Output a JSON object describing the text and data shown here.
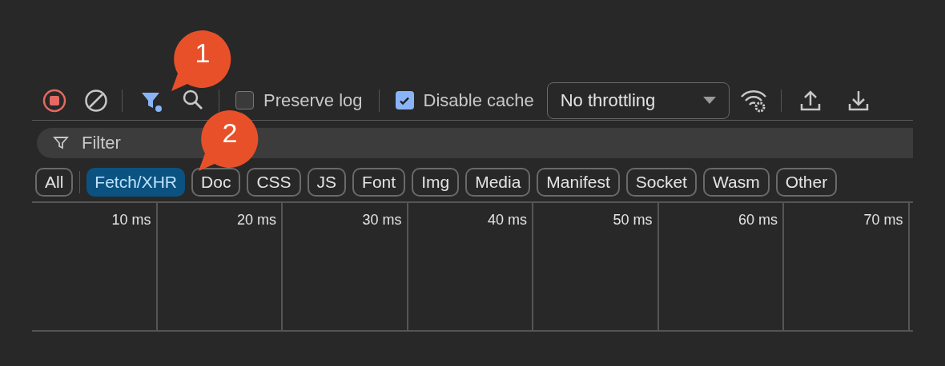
{
  "callouts": [
    {
      "label": "1"
    },
    {
      "label": "2"
    }
  ],
  "toolbar": {
    "recording": true,
    "filter_on": true,
    "preserve_log": {
      "label": "Preserve log",
      "checked": false
    },
    "disable_cache": {
      "label": "Disable cache",
      "checked": true
    },
    "throttling": {
      "value": "No throttling"
    }
  },
  "filter": {
    "placeholder": "Filter"
  },
  "type_filters": [
    {
      "label": "All",
      "selected": false
    },
    {
      "label": "Fetch/XHR",
      "selected": true
    },
    {
      "label": "Doc",
      "selected": false
    },
    {
      "label": "CSS",
      "selected": false
    },
    {
      "label": "JS",
      "selected": false
    },
    {
      "label": "Font",
      "selected": false
    },
    {
      "label": "Img",
      "selected": false
    },
    {
      "label": "Media",
      "selected": false
    },
    {
      "label": "Manifest",
      "selected": false
    },
    {
      "label": "Socket",
      "selected": false
    },
    {
      "label": "Wasm",
      "selected": false
    },
    {
      "label": "Other",
      "selected": false
    }
  ],
  "timeline": {
    "ticks": [
      "10 ms",
      "20 ms",
      "30 ms",
      "40 ms",
      "50 ms",
      "60 ms",
      "70 ms"
    ]
  }
}
